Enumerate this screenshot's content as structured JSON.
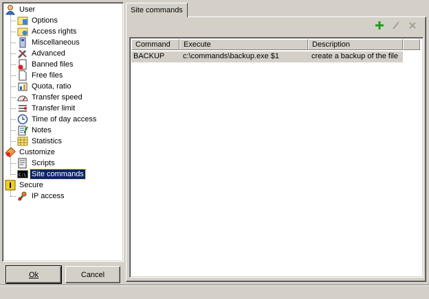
{
  "tree": {
    "user": {
      "label": "User",
      "children": [
        {
          "label": "Options"
        },
        {
          "label": "Access rights"
        },
        {
          "label": "Miscellaneous"
        },
        {
          "label": "Advanced"
        },
        {
          "label": "Banned files"
        },
        {
          "label": "Free files"
        },
        {
          "label": "Quota, ratio"
        },
        {
          "label": "Transfer speed"
        },
        {
          "label": "Transfer limit"
        },
        {
          "label": "Time of day access"
        },
        {
          "label": "Notes"
        },
        {
          "label": "Statistics"
        }
      ]
    },
    "customize": {
      "label": "Customize",
      "children": [
        {
          "label": "Scripts"
        },
        {
          "label": "Site commands",
          "selected": true
        }
      ]
    },
    "secure": {
      "label": "Secure",
      "children": [
        {
          "label": "IP access"
        }
      ]
    }
  },
  "buttons": {
    "ok": "Ok",
    "cancel": "Cancel"
  },
  "tab": {
    "label": "Site commands"
  },
  "toolbar": {
    "add_icon": "plus-icon",
    "edit_icon": "pencil-icon",
    "delete_icon": "delete-icon"
  },
  "table": {
    "columns": [
      "Command",
      "Execute",
      "Description"
    ],
    "rows": [
      [
        "BACKUP",
        "c:\\commands\\backup.exe $1",
        "create a backup of the file"
      ]
    ]
  },
  "colors": {
    "selection": "#0a246a",
    "face": "#d4d0c8",
    "add_green": "#1e9a1e"
  }
}
